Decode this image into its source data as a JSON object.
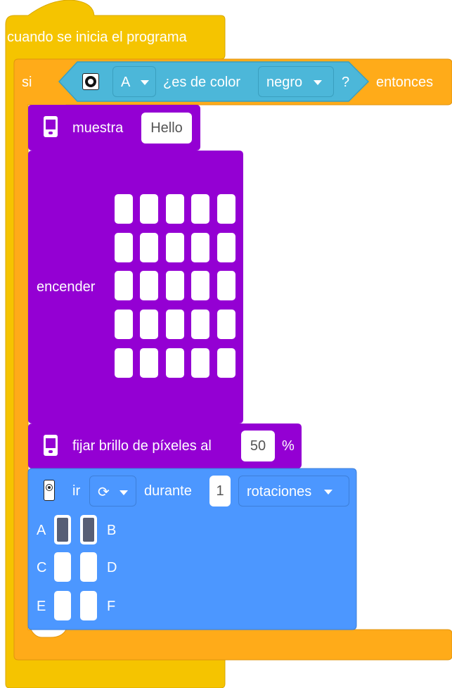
{
  "hat": {
    "label": "cuando se inicia el programa"
  },
  "if_block": {
    "prefix": "si",
    "suffix": "entonces",
    "condition": {
      "sensor_port": "A",
      "question": "¿es de color",
      "color_value": "negro",
      "question_end": "?"
    }
  },
  "display_text": {
    "label": "muestra",
    "value": "Hello"
  },
  "light_matrix": {
    "label": "encender",
    "rows": 5,
    "cols": 5
  },
  "brightness": {
    "label": "fijar brillo de píxeles al",
    "value": "50",
    "unit": "%"
  },
  "motor": {
    "label": "ir",
    "direction": "clockwise",
    "during_label": "durante",
    "amount": "1",
    "unit": "rotaciones",
    "ports": [
      {
        "name": "A",
        "selected": true
      },
      {
        "name": "B",
        "selected": true
      },
      {
        "name": "C",
        "selected": false
      },
      {
        "name": "D",
        "selected": false
      },
      {
        "name": "E",
        "selected": false
      },
      {
        "name": "F",
        "selected": false
      }
    ]
  },
  "colors": {
    "events": "#f5c400",
    "control": "#ffab19",
    "sensors": "#4cb7d9",
    "display": "#9400d3",
    "motors": "#4c97ff"
  }
}
